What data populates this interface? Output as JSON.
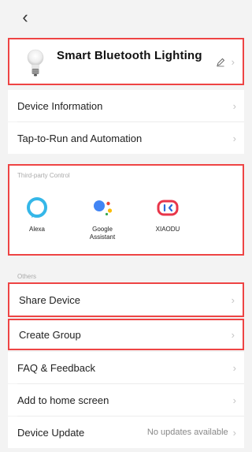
{
  "nav": {
    "back_glyph": "‹"
  },
  "device": {
    "name": "Smart Bluetooth Lighting",
    "icon": "bulb-icon"
  },
  "rows_top": [
    {
      "label": "Device Information"
    },
    {
      "label": "Tap-to-Run and Automation"
    }
  ],
  "third_party": {
    "title": "Third-party Control",
    "items": [
      {
        "label": "Alexa",
        "icon": "alexa-icon"
      },
      {
        "label": "Google\nAssistant",
        "icon": "google-assistant-icon"
      },
      {
        "label": "XIAODU",
        "icon": "xiaodu-icon"
      }
    ]
  },
  "others": {
    "title": "Others",
    "rows": [
      {
        "label": "Share Device"
      },
      {
        "label": "Create Group"
      },
      {
        "label": "FAQ & Feedback"
      },
      {
        "label": "Add to home screen"
      },
      {
        "label": "Device Update",
        "value": "No updates available"
      }
    ]
  },
  "colors": {
    "highlight_border": "#e44444",
    "alexa": "#35b7e8",
    "google_blue": "#4285f4",
    "google_red": "#ea4335",
    "google_yellow": "#fbbc05",
    "google_green": "#34a853",
    "xiaodu_red": "#e8364a",
    "xiaodu_blue": "#2c6bd9"
  }
}
